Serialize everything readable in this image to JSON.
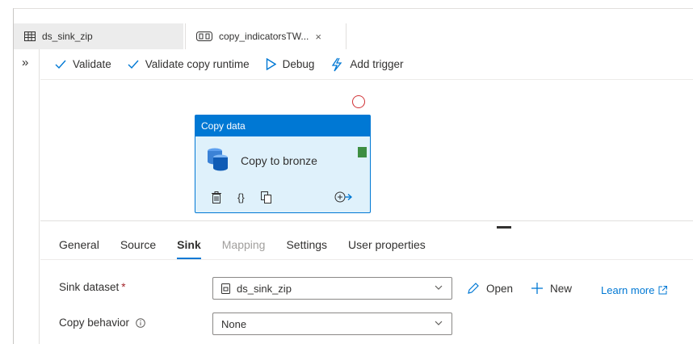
{
  "tabs": [
    {
      "label": "ds_sink_zip",
      "icon": "table-icon"
    },
    {
      "label": "copy_indicatorsTW...",
      "icon": "pipeline-icon",
      "close": "×"
    }
  ],
  "gutter": {
    "expand": "»"
  },
  "toolbar": {
    "validate": "Validate",
    "validate_runtime": "Validate copy runtime",
    "debug": "Debug",
    "add_trigger": "Add trigger"
  },
  "activity": {
    "type": "Copy data",
    "name": "Copy to bronze",
    "tools": {
      "params": "{}"
    }
  },
  "properties": {
    "tabs": [
      "General",
      "Source",
      "Sink",
      "Mapping",
      "Settings",
      "User properties"
    ],
    "active_tab": "Sink",
    "sink_dataset_label": "Sink dataset",
    "required_mark": "*",
    "sink_dataset_value": "ds_sink_zip",
    "open": "Open",
    "new": "New",
    "learn_more": "Learn more",
    "copy_behavior_label": "Copy behavior",
    "copy_behavior_value": "None"
  },
  "colors": {
    "accent": "#0078d4",
    "activity_bg": "#dff1fb",
    "required": "#a4262c",
    "error_circle": "#d13438",
    "success_port": "#3e8e41"
  }
}
